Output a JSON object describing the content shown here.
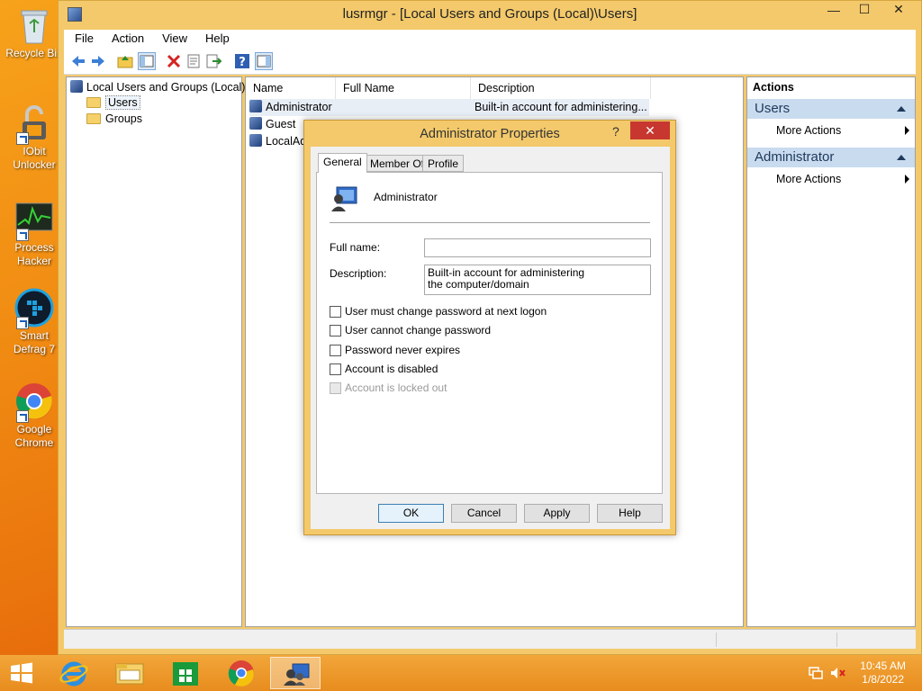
{
  "desktop": {
    "icons": [
      {
        "label": "Recycle Bin"
      },
      {
        "label": "IObit Unlocker"
      },
      {
        "label": "Process Hacker"
      },
      {
        "label": "Smart Defrag 7"
      },
      {
        "label": "Google Chrome"
      }
    ]
  },
  "window": {
    "title": "lusrmgr - [Local Users and Groups (Local)\\Users]",
    "controls": {
      "minimize": "—",
      "maximize": "☐",
      "close": "✕"
    },
    "menu": [
      "File",
      "Action",
      "View",
      "Help"
    ],
    "tree": {
      "root": "Local Users and Groups (Local)",
      "children": [
        "Users",
        "Groups"
      ]
    },
    "list": {
      "columns": [
        "Name",
        "Full Name",
        "Description"
      ],
      "rows": [
        {
          "name": "Administrator",
          "full_name": "",
          "description": "Built-in account for administering..."
        },
        {
          "name": "Guest",
          "full_name": "",
          "description": ""
        },
        {
          "name": "LocalAd",
          "full_name": "",
          "description": ""
        }
      ]
    },
    "actions": {
      "title": "Actions",
      "sections": [
        {
          "header": "Users",
          "item": "More Actions"
        },
        {
          "header": "Administrator",
          "item": "More Actions"
        }
      ]
    }
  },
  "dialog": {
    "title": "Administrator Properties",
    "help": "?",
    "close": "✕",
    "tabs": [
      "General",
      "Member Of",
      "Profile"
    ],
    "user_name": "Administrator",
    "full_name_label": "Full name:",
    "full_name_value": "",
    "description_label": "Description:",
    "description_value": "Built-in account for administering the computer/domain",
    "checkboxes": [
      {
        "label": "User must change password at next logon",
        "checked": false,
        "disabled": false
      },
      {
        "label": "User cannot change password",
        "checked": false,
        "disabled": false
      },
      {
        "label": "Password never expires",
        "checked": false,
        "disabled": false
      },
      {
        "label": "Account is disabled",
        "checked": false,
        "disabled": false
      },
      {
        "label": "Account is locked out",
        "checked": false,
        "disabled": true
      }
    ],
    "buttons": {
      "ok": "OK",
      "cancel": "Cancel",
      "apply": "Apply",
      "help": "Help"
    }
  },
  "taskbar": {
    "time": "10:45 AM",
    "date": "1/8/2022"
  },
  "colors": {
    "desktop": "#f08a12",
    "window_frame": "#f3c96b",
    "close_red": "#c7372f",
    "actions_header": "#c9dbef"
  }
}
